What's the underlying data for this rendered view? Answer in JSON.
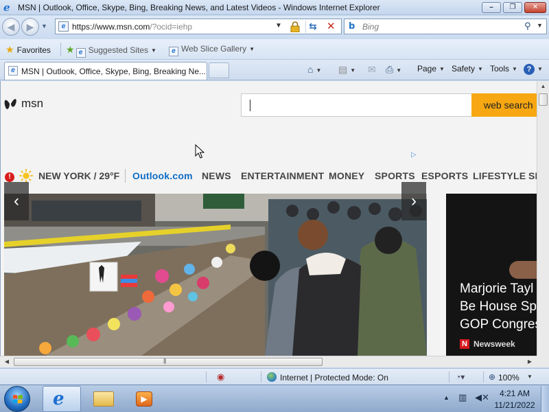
{
  "window": {
    "title": "MSN | Outlook, Office, Skype, Bing, Breaking News, and Latest Videos - Windows Internet Explorer",
    "minimize_glyph": "–",
    "maximize_glyph": "❐",
    "close_glyph": "✕"
  },
  "address_bar": {
    "url_host": "https://www.msn.com",
    "url_rest": "/?ocid=iehp"
  },
  "search_bar": {
    "placeholder": "Bing"
  },
  "favorites_bar": {
    "favorites_label": "Favorites",
    "items": [
      {
        "label": "Suggested Sites",
        "icon": "ie-page-icon"
      },
      {
        "label": "Web Slice Gallery",
        "icon": "ie-page-icon"
      }
    ]
  },
  "tabs": [
    {
      "title": "MSN | Outlook, Office, Skype, Bing, Breaking Ne...",
      "active": true
    }
  ],
  "command_bar": {
    "page_label": "Page",
    "safety_label": "Safety",
    "tools_label": "Tools"
  },
  "page": {
    "logo_text": "msn",
    "search_button_label": "web search",
    "weather": "NEW YORK / 29°F",
    "nav_links": [
      "Outlook.com",
      "NEWS",
      "ENTERTAINMENT",
      "MONEY",
      "SPORTS",
      "ESPORTS",
      "LIFESTYLE",
      "SH"
    ],
    "side_story": {
      "headline": "Marjorie Tayl\nBe House Spe\nGOP Congres",
      "source_badge": "N",
      "source": "Newsweek"
    }
  },
  "status_bar": {
    "zone": "Internet | Protected Mode: On",
    "zoom": "100%"
  },
  "taskbar": {
    "time": "4:21 AM",
    "date": "11/21/2022",
    "apps": [
      "internet-explorer",
      "windows-explorer",
      "windows-media-player"
    ]
  },
  "colors": {
    "accent_search_button": "#f6a712",
    "outlook_link": "#0e6cc4",
    "alert": "#d91c1c",
    "newsweek_red": "#d7191d"
  }
}
